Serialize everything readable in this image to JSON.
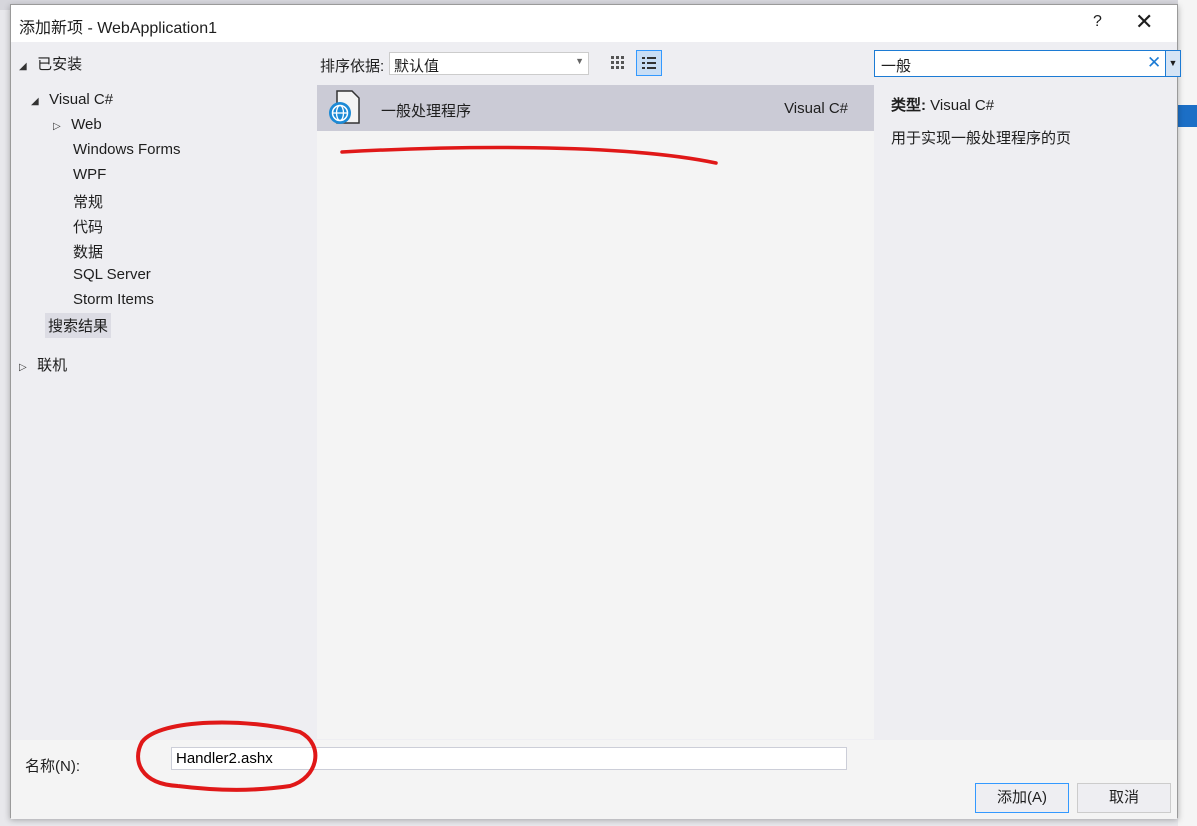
{
  "dialog": {
    "title": "添加新项 - WebApplication1",
    "help": "?",
    "close": "✕"
  },
  "tree": {
    "installed": "已安装",
    "visual_csharp": "Visual C#",
    "children": [
      "Web",
      "Windows Forms",
      "WPF",
      "常规",
      "代码",
      "数据",
      "SQL Server",
      "Storm Items"
    ],
    "search_results": "搜索结果",
    "online": "联机"
  },
  "sort": {
    "label": "排序依据:",
    "value": "默认值"
  },
  "search": {
    "value": "一般"
  },
  "list": {
    "items": [
      {
        "name": "一般处理程序",
        "type": "Visual C#",
        "icon": "globe-file-icon"
      }
    ]
  },
  "details": {
    "type_label": "类型:",
    "type_value": "Visual C#",
    "description": "用于实现一般处理程序的页"
  },
  "name_field": {
    "label": "名称(N):",
    "value": "Handler2.ashx"
  },
  "buttons": {
    "add": "添加(A)",
    "cancel": "取消"
  },
  "colors": {
    "accent": "#1c7bd4",
    "selected": "#cbcbd6",
    "annotation": "#e01818"
  }
}
